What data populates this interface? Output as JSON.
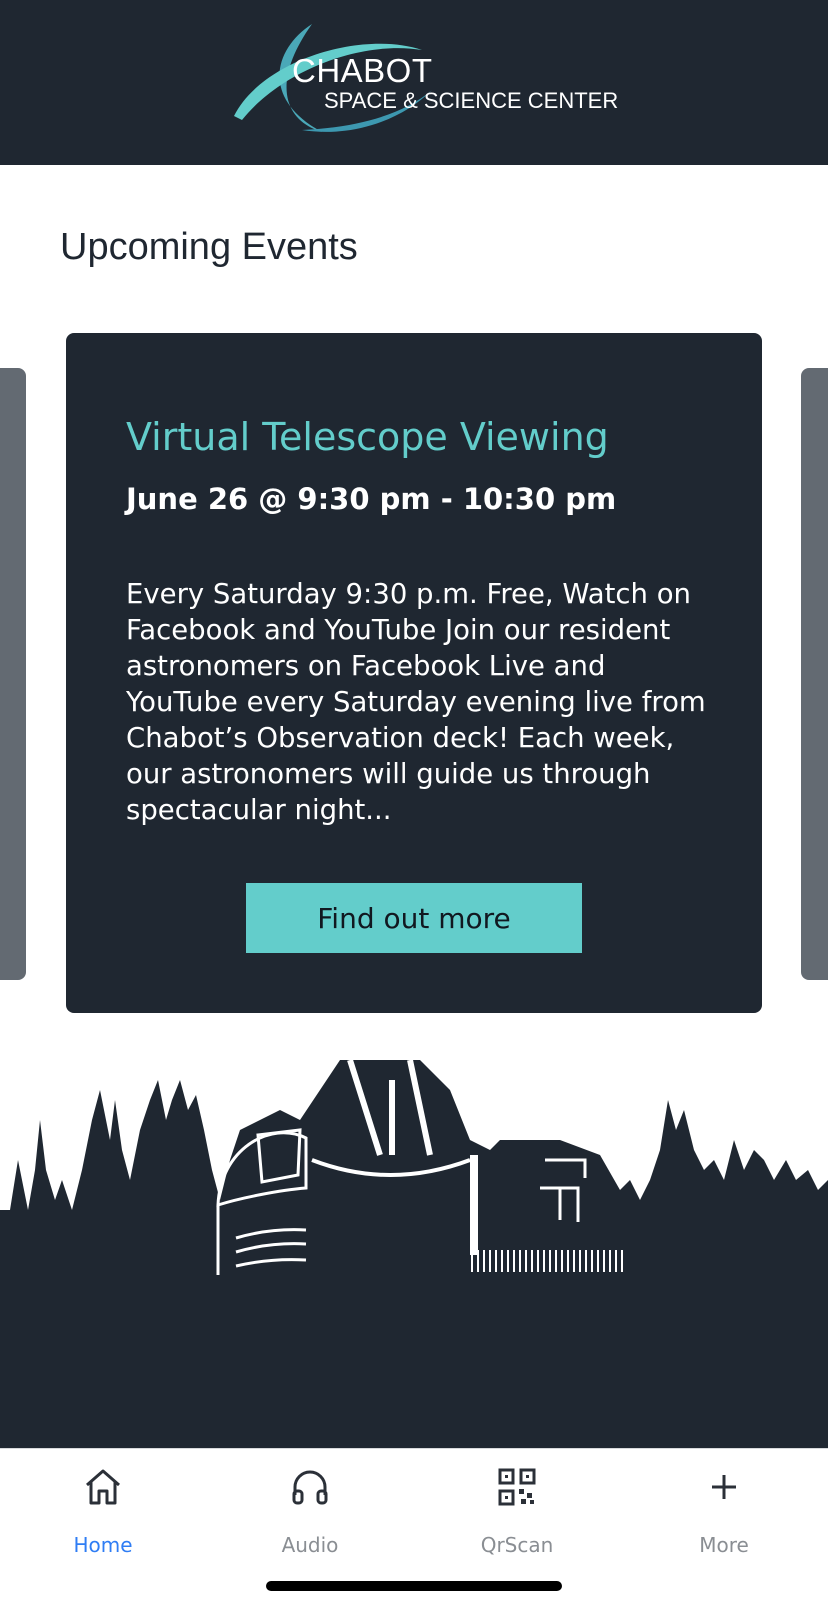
{
  "header": {
    "logo_line1": "CHABOT",
    "logo_line2": "SPACE & SCIENCE CENTER"
  },
  "events": {
    "section_title": "Upcoming Events",
    "card": {
      "title": "Virtual Telescope Viewing",
      "date": "June 26 @ 9:30 pm - 10:30 pm",
      "description": "Every Saturday 9:30 p.m. Free, Watch on Facebook and YouTube Join our resident astronomers on Facebook Live and YouTube every Saturday evening live from Chabot’s Observation deck! Each week, our astronomers will guide us through spectacular night...",
      "button_label": "Find out more"
    }
  },
  "tabbar": {
    "items": [
      {
        "label": "Home",
        "icon": "home-icon",
        "active": true
      },
      {
        "label": "Audio",
        "icon": "headphones-icon",
        "active": false
      },
      {
        "label": "QrScan",
        "icon": "qr-code-icon",
        "active": false
      },
      {
        "label": "More",
        "icon": "plus-icon",
        "active": false
      }
    ]
  },
  "colors": {
    "navy": "#1f2731",
    "teal": "#63cdcb",
    "active_tab": "#2f7df4",
    "inactive_tab": "#8a8e93"
  }
}
